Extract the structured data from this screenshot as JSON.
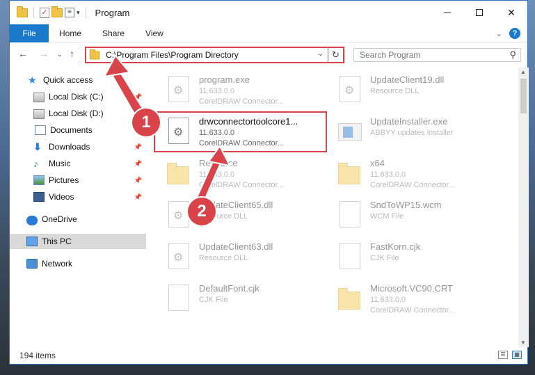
{
  "window": {
    "title": "Program"
  },
  "ribbon": {
    "file": "File",
    "tabs": [
      "Home",
      "Share",
      "View"
    ]
  },
  "address": {
    "path": "C:\\Program Files\\Program Directory"
  },
  "search": {
    "placeholder": "Search Program"
  },
  "sidebar": {
    "items": [
      {
        "label": "Quick access",
        "icon": "star-icon"
      },
      {
        "label": "Local Disk (C:)",
        "icon": "drive-icon"
      },
      {
        "label": "Local Disk (D:)",
        "icon": "drive-icon"
      },
      {
        "label": "Documents",
        "icon": "documents-icon"
      },
      {
        "label": "Downloads",
        "icon": "downloads-icon"
      },
      {
        "label": "Music",
        "icon": "music-icon"
      },
      {
        "label": "Pictures",
        "icon": "pictures-icon"
      },
      {
        "label": "Videos",
        "icon": "videos-icon"
      },
      {
        "label": "OneDrive",
        "icon": "onedrive-icon"
      },
      {
        "label": "This PC",
        "icon": "this-pc-icon"
      },
      {
        "label": "Network",
        "icon": "network-icon"
      }
    ]
  },
  "files": [
    {
      "name": "program.exe",
      "line2": "11.633.0.0",
      "line3": "CorelDRAW Connector...",
      "icon": "exe-icon"
    },
    {
      "name": "UpdateClient19.dll",
      "line2": "Resource DLL",
      "line3": "",
      "icon": "dll-icon"
    },
    {
      "name": "drwconnectortoolcore1...",
      "line2": "11.633.0.0",
      "line3": "CorelDRAW Connector...",
      "icon": "dll-gear-icon"
    },
    {
      "name": "UpdateInstaller.exe",
      "line2": "ABBYY updates installer",
      "line3": "",
      "icon": "installer-icon"
    },
    {
      "name": "Resource",
      "line2": "11.633.0.0",
      "line3": "CorelDRAW Connector...",
      "icon": "folder-icon"
    },
    {
      "name": "x64",
      "line2": "11.633.0.0",
      "line3": "CorelDRAW Connector...",
      "icon": "folder-icon"
    },
    {
      "name": "UpdateClient65.dll",
      "line2": "Resource DLL",
      "line3": "",
      "icon": "dll-icon"
    },
    {
      "name": "SndToWP15.wcm",
      "line2": "WCM File",
      "line3": "",
      "icon": "file-icon"
    },
    {
      "name": "UpdateClient63.dll",
      "line2": "Resource DLL",
      "line3": "",
      "icon": "dll-icon"
    },
    {
      "name": "FastKorn.cjk",
      "line2": "CJK File",
      "line3": "",
      "icon": "file-icon"
    },
    {
      "name": "DefaultFont.cjk",
      "line2": "CJK File",
      "line3": "",
      "icon": "file-icon"
    },
    {
      "name": "Microsoft.VC90.CRT",
      "line2": "11.633.0.0",
      "line3": "CorelDRAW Connector...",
      "icon": "folder-icon"
    }
  ],
  "status": {
    "count": "194 items"
  },
  "annotations": {
    "badge1": "1",
    "badge2": "2",
    "color": "#d9434a"
  }
}
